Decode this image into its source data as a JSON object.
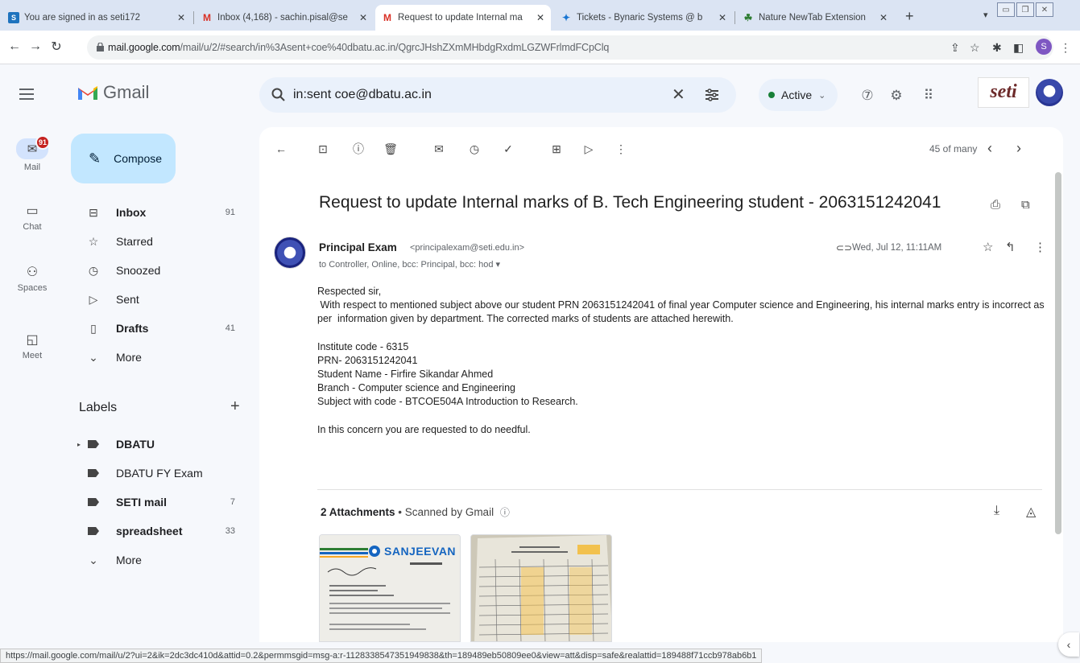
{
  "browser": {
    "tabs": [
      {
        "label": "You are signed in as seti172",
        "favicon": "seti-favicon",
        "favicon_letter": "S"
      },
      {
        "label": "Inbox (4,168) - sachin.pisal@se",
        "favicon": "gmail-favicon",
        "favicon_letter": "M"
      },
      {
        "label": "Request to update Internal ma",
        "favicon": "gmail-favicon",
        "favicon_letter": "M",
        "active": true
      },
      {
        "label": "Tickets - Bynaric Systems @ b",
        "favicon": "tickets-favicon",
        "favicon_letter": "✦"
      },
      {
        "label": "Nature NewTab Extension",
        "favicon": "leaf-favicon",
        "favicon_letter": "☘"
      }
    ],
    "url_host": "mail.google.com",
    "url_path": "/mail/u/2/#search/in%3Asent+coe%40dbatu.ac.in/QgrcJHshZXmMHbdgRxdmLGZWFrlmdFCpClq",
    "profile_initial": "S",
    "status_url": "https://mail.google.com/mail/u/2?ui=2&ik=2dc3dc410d&attid=0.2&permmsgid=msg-a:r-1128338547351949838&th=189489eb50809ee0&view=att&disp=safe&realattid=189488f71ccb978ab6b1"
  },
  "gmail": {
    "logo_word": "Gmail",
    "search_query": "in:sent coe@dbatu.ac.in",
    "status": "Active",
    "org_logo_text": "seti"
  },
  "rail": {
    "mail_label": "Mail",
    "mail_badge": "91",
    "chat_label": "Chat",
    "spaces_label": "Spaces",
    "meet_label": "Meet"
  },
  "sidebar": {
    "compose_label": "Compose",
    "items": [
      {
        "label": "Inbox",
        "count": "91",
        "icon": "inbox-icon",
        "bold": true
      },
      {
        "label": "Starred",
        "count": "",
        "icon": "star-icon",
        "bold": false
      },
      {
        "label": "Snoozed",
        "count": "",
        "icon": "clock-icon",
        "bold": false
      },
      {
        "label": "Sent",
        "count": "",
        "icon": "send-icon",
        "bold": false
      },
      {
        "label": "Drafts",
        "count": "41",
        "icon": "draft-icon",
        "bold": true
      },
      {
        "label": "More",
        "count": "",
        "icon": "chevron-down-icon",
        "bold": false
      }
    ],
    "labels_title": "Labels",
    "labels": [
      {
        "label": "DBATU",
        "count": "",
        "bold": true
      },
      {
        "label": "DBATU FY Exam",
        "count": "",
        "bold": false
      },
      {
        "label": "SETI mail",
        "count": "7",
        "bold": true
      },
      {
        "label": "spreadsheet",
        "count": "33",
        "bold": true
      },
      {
        "label": "More",
        "count": "",
        "bold": false
      }
    ]
  },
  "message": {
    "pager": "45 of many",
    "subject": "Request to update Internal marks of B. Tech Engineering student - 2063151242041",
    "sender_name": "Principal Exam",
    "sender_email": "<principalexam@seti.edu.in>",
    "recipients": "to Controller, Online, bcc: Principal, bcc: hod ▾",
    "date": "Wed, Jul 12, 11:11AM",
    "greeting": "Respected sir,",
    "para1": " With respect to mentioned subject above our student PRN 2063151242041 of final year Computer science and Engineering, his internal marks entry is incorrect as per  information given by department. The corrected marks of students are attached herewith.",
    "details": [
      "Institute code - 6315",
      "PRN- 2063151242041",
      "Student Name - Firfire Sikandar Ahmed",
      "Branch - Computer science and Engineering",
      "Subject with code - BTCOE504A Introduction to Research."
    ],
    "closing": "In this concern you are requested to do needful.",
    "attachments_title": "2 Attachments",
    "attachments_sub": " •  Scanned by Gmail",
    "attachment1_brand": "SANJEEVAN"
  }
}
